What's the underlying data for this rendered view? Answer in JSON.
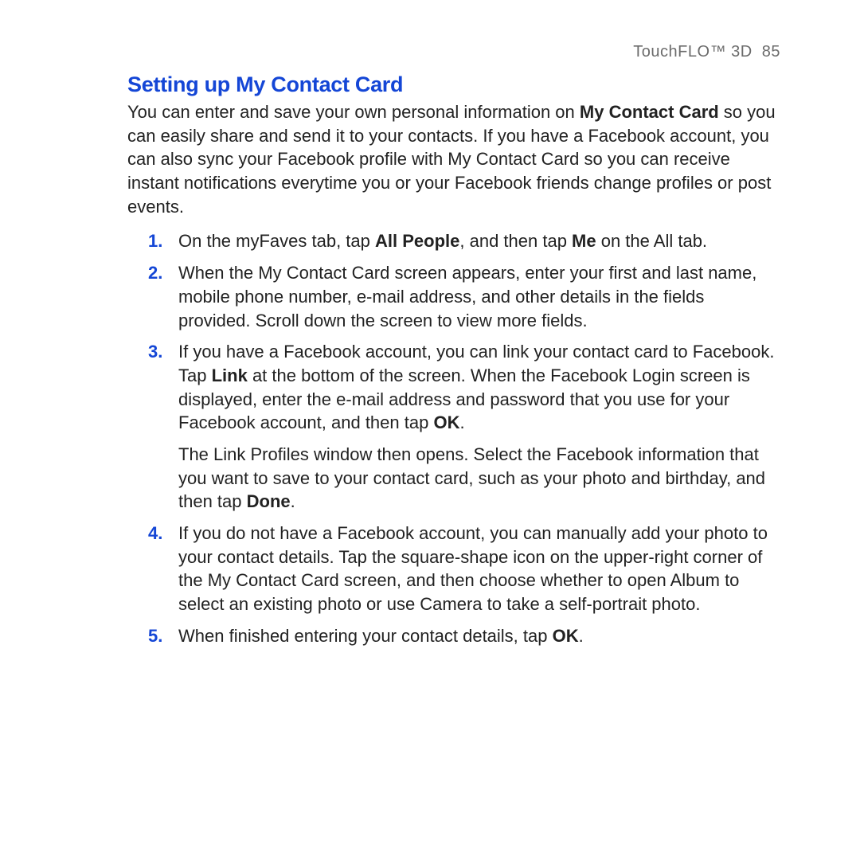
{
  "header": {
    "running_title": "TouchFLO™ 3D",
    "page_number": "85"
  },
  "section": {
    "title": "Setting up My Contact Card",
    "intro_pre": "You can enter and save your own personal information on ",
    "intro_bold": "My Contact Card",
    "intro_post": " so you can easily share and send it to your contacts. If you have a Facebook account, you can also sync your Facebook profile with My Contact Card so you can receive instant notifications everytime you or your Facebook friends change profiles or post events."
  },
  "steps": {
    "s1": {
      "a": "On the myFaves tab, tap ",
      "b1": "All People",
      "c": ", and then tap ",
      "b2": "Me",
      "d": " on the All tab."
    },
    "s2": {
      "a": "When the My Contact Card screen appears, enter your first and last name, mobile phone number, e-mail address, and other details in the fields provided. Scroll down the screen to view more fields."
    },
    "s3": {
      "a": "If you have a Facebook account, you can link your contact card to Facebook. Tap ",
      "b1": "Link",
      "c": " at the bottom of the screen. When the Facebook Login screen is displayed, enter the e-mail address and password that you use for your Facebook account, and then tap ",
      "b2": "OK",
      "d": ".",
      "sub_a": "The Link Profiles window then opens. Select the Facebook information that you want to save to your contact card, such as your photo and birthday, and then tap ",
      "sub_b": "Done",
      "sub_c": "."
    },
    "s4": {
      "a": "If you do not have a Facebook account, you can manually add your photo to your contact details. Tap the square-shape icon on the upper-right corner of the My Contact Card screen, and then choose whether to open Album to select an existing photo or use Camera to take a self-portrait photo."
    },
    "s5": {
      "a": "When finished entering your contact details, tap ",
      "b1": "OK",
      "c": "."
    }
  }
}
